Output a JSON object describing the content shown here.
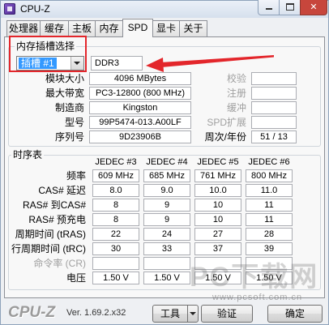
{
  "app": {
    "title": "CPU-Z",
    "icon": "cpuz-app-icon"
  },
  "window_controls": {
    "minimize_icon": "minimize-icon",
    "maximize_icon": "maximize-icon",
    "close_icon": "close-icon"
  },
  "tabs": [
    {
      "label": "处理器"
    },
    {
      "label": "缓存"
    },
    {
      "label": "主板"
    },
    {
      "label": "内存"
    },
    {
      "label": "SPD",
      "active": true
    },
    {
      "label": "显卡"
    },
    {
      "label": "关于"
    }
  ],
  "slot_selection": {
    "group_title": "内存插槽选择",
    "slot_dropdown": {
      "selected": "插槽 #1",
      "icon": "chevron-down-icon"
    },
    "memory_type": "DDR3",
    "module_size": {
      "label": "模块大小",
      "value": "4096 MBytes"
    },
    "max_bandwidth": {
      "label": "最大带宽",
      "value": "PC3-12800 (800 MHz)"
    },
    "manufacturer": {
      "label": "制造商",
      "value": "Kingston"
    },
    "part_number": {
      "label": "型号",
      "value": "99P5474-013.A00LF"
    },
    "serial_number": {
      "label": "序列号",
      "value": "9D23906B"
    },
    "correction": {
      "label": "校验"
    },
    "registered": {
      "label": "注册"
    },
    "buffered": {
      "label": "缓冲"
    },
    "spd_ext": {
      "label": "SPD扩展"
    },
    "week_year": {
      "label": "周次/年份",
      "value": "51 / 13"
    }
  },
  "timings": {
    "group_title": "时序表",
    "columns": [
      "JEDEC #3",
      "JEDEC #4",
      "JEDEC #5",
      "JEDEC #6"
    ],
    "rows": [
      {
        "label": "频率",
        "values": [
          "609 MHz",
          "685 MHz",
          "761 MHz",
          "800 MHz"
        ]
      },
      {
        "label": "CAS# 延迟",
        "values": [
          "8.0",
          "9.0",
          "10.0",
          "11.0"
        ]
      },
      {
        "label": "RAS# 到CAS#",
        "values": [
          "8",
          "9",
          "10",
          "11"
        ]
      },
      {
        "label": "RAS# 预充电",
        "values": [
          "8",
          "9",
          "10",
          "11"
        ]
      },
      {
        "label": "周期时间 (tRAS)",
        "values": [
          "22",
          "24",
          "27",
          "28"
        ]
      },
      {
        "label": "行周期时间 (tRC)",
        "values": [
          "30",
          "33",
          "37",
          "39"
        ]
      },
      {
        "label": "命令率 (CR)",
        "values": [
          "",
          "",
          "",
          ""
        ]
      },
      {
        "label": "电压",
        "values": [
          "1.50 V",
          "1.50 V",
          "1.50 V",
          "1.50 V"
        ]
      }
    ]
  },
  "footer": {
    "logo": "CPU-Z",
    "version": "Ver. 1.69.2.x32",
    "tools_button": "工具",
    "validate_button": "验证",
    "ok_button": "确定"
  },
  "watermark": {
    "text": "PC下载网",
    "url": "www.pcsoft.com.cn"
  },
  "colors": {
    "selection": "#3399ff",
    "annotation": "#e3262b",
    "close_button": "#c7463c",
    "disabled_text": "#a0a0a0"
  }
}
